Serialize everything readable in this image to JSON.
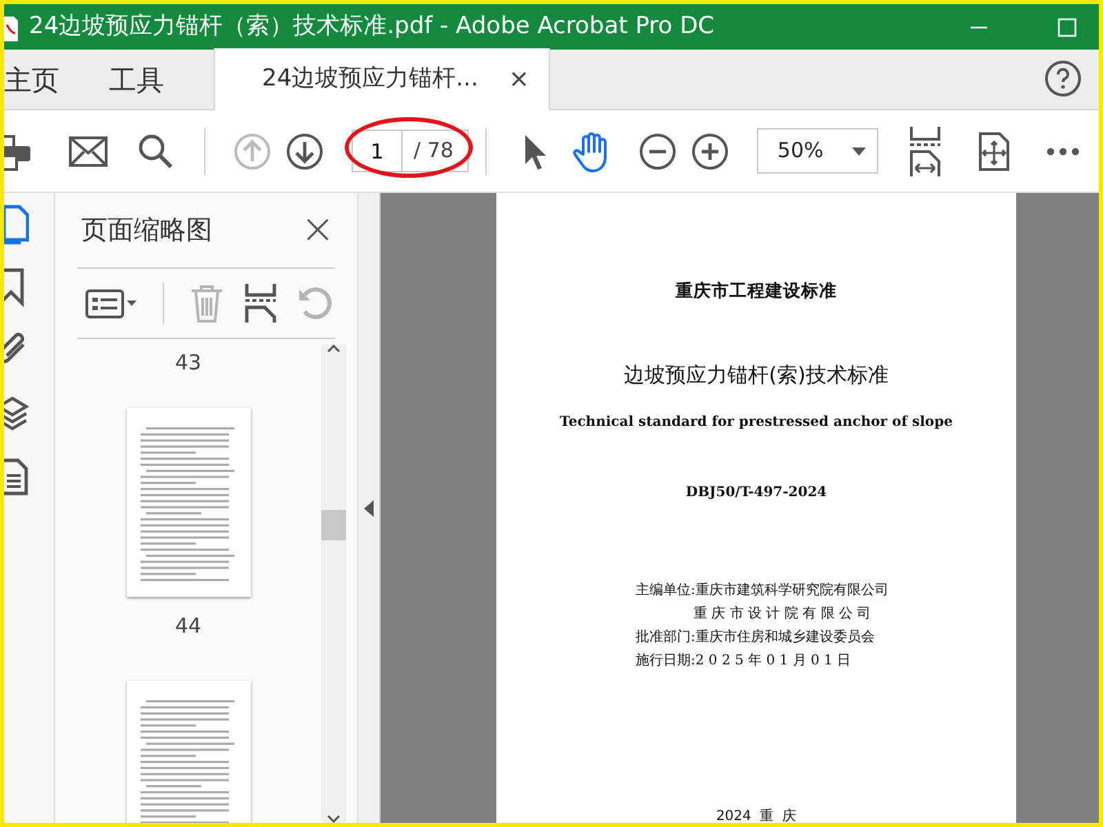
{
  "window": {
    "title": "24边坡预应力锚杆（索）技术标准.pdf - Adobe Acrobat Pro DC"
  },
  "tabs": [
    {
      "label": "主页",
      "selected": false
    },
    {
      "label": "工具",
      "selected": false
    },
    {
      "label": "24边坡预应力锚杆...",
      "selected": true,
      "close": "×"
    }
  ],
  "toolbar": {
    "page_nav": [
      {
        "kind": "up",
        "disabled": true
      },
      {
        "kind": "down",
        "disabled": false
      }
    ],
    "page_number": "1",
    "page_count": "/ 78",
    "tools": [
      {
        "kind": "select",
        "selected": false
      },
      {
        "kind": "hand",
        "selected": true
      }
    ],
    "zoom": "50%"
  },
  "rail": [
    {
      "kind": "pages",
      "selected": true
    },
    {
      "kind": "bookmarks",
      "selected": false
    },
    {
      "kind": "attachments",
      "selected": false
    },
    {
      "kind": "layers",
      "selected": false
    },
    {
      "kind": "content",
      "selected": false
    }
  ],
  "sidebar": {
    "title": "页面缩略图",
    "close": "×",
    "tools": [
      {
        "kind": "options",
        "disabled": false
      },
      {
        "kind": "delete",
        "disabled": true
      },
      {
        "kind": "insert",
        "disabled": false
      },
      {
        "kind": "undo",
        "disabled": true
      }
    ],
    "thumbnails": [
      {
        "label": "43"
      },
      {
        "label": "44"
      }
    ]
  },
  "document": {
    "lines": [
      {
        "kind": "series",
        "text": "重庆市工程建设标准"
      },
      {
        "kind": "title",
        "text": "边坡预应力锚杆(索)技术标准"
      },
      {
        "kind": "english",
        "text": "Technical standard for prestressed anchor of slope"
      },
      {
        "kind": "code",
        "text": "DBJ50/T-497-2024"
      },
      {
        "kind": "info",
        "text": "主编单位:重庆市建筑科学研究院有限公司"
      },
      {
        "kind": "info-cont",
        "text": "重 庆 市 设 计 院 有 限 公 司"
      },
      {
        "kind": "info",
        "text": "批准部门:重庆市住房和城乡建设委员会"
      },
      {
        "kind": "info",
        "text": "施行日期:2 0 2 5 年 0 1 月 0 1 日"
      },
      {
        "kind": "footer",
        "text": "2024  重  庆"
      }
    ]
  }
}
